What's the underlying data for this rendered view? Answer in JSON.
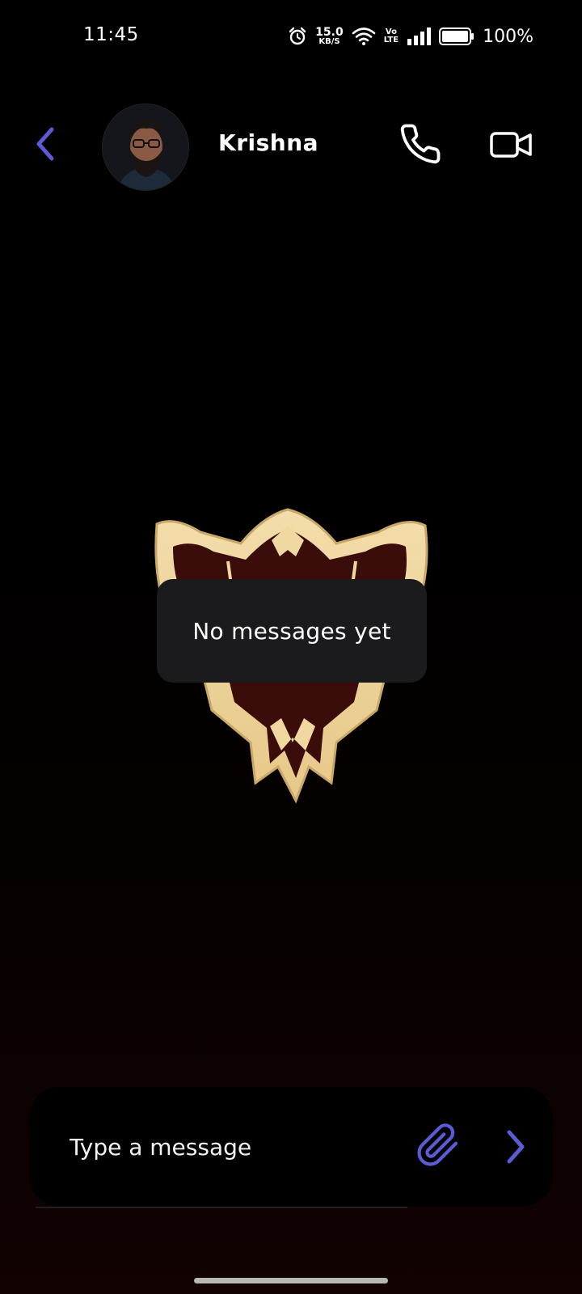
{
  "status_bar": {
    "time": "11:45",
    "net_speed_value": "15.0",
    "net_speed_unit": "KB/S",
    "volte_top": "Vo",
    "volte_bottom": "LTE",
    "battery_percent": "100%",
    "icons": [
      "alarm-icon",
      "wifi-icon",
      "volte-icon",
      "signal-icon",
      "battery-icon"
    ]
  },
  "header": {
    "contact_name": "Krishna",
    "icons": [
      "back-arrow-icon",
      "phone-icon",
      "video-camera-icon"
    ],
    "accent_color": "#5b5bd6"
  },
  "conversation": {
    "empty_text": "No messages yet",
    "background_emblem": "black-bull-emblem"
  },
  "composer": {
    "placeholder": "Type a message",
    "icons": [
      "paperclip-icon",
      "send-chevron-icon"
    ]
  },
  "colors": {
    "accent": "#5b5bd6",
    "bubble": "#1b1b1d",
    "emblem_gold": "#f0d9a0",
    "emblem_dark": "#3a0c0a"
  }
}
